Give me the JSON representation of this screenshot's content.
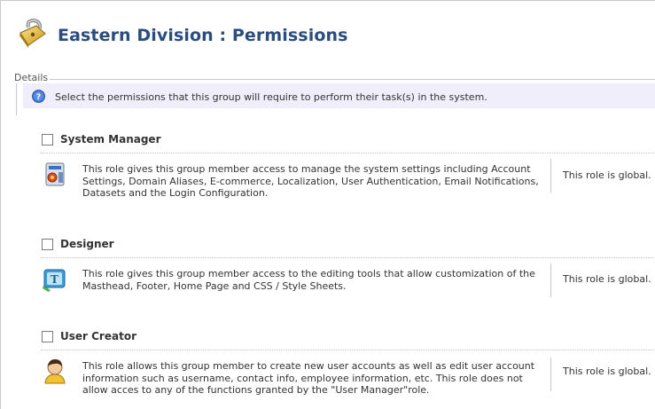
{
  "page": {
    "title": "Eastern Division : Permissions"
  },
  "details": {
    "legend": "Details",
    "info_text": "Select the permissions that this group will require to perform their task(s) in the system."
  },
  "roles": [
    {
      "name": "System Manager",
      "checked": false,
      "icon": "system-manager-icon",
      "description": "This role gives this group member access to manage the system settings including Account Settings, Domain Aliases, E-commerce, Localization, User Authentication, Email Notifications, Datasets and the Login Configuration.",
      "scope": "This role is global."
    },
    {
      "name": "Designer",
      "checked": false,
      "icon": "designer-icon",
      "description": "This role gives this group member access to the editing tools that allow customization of the Masthead, Footer, Home Page and CSS / Style Sheets.",
      "scope": "This role is global."
    },
    {
      "name": "User Creator",
      "checked": false,
      "icon": "user-creator-icon",
      "description": "This role allows this group member to create new user accounts as well as edit user account information such as username, contact info, employee information, etc. This role does not allow acces to any of the functions granted by the \"User Manager\"role.",
      "scope": "This role is global."
    }
  ]
}
